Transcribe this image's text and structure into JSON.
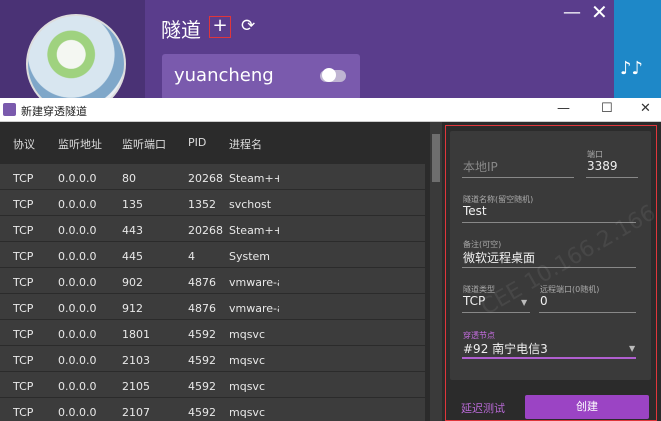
{
  "app": {
    "title": "隧道",
    "add_symbol": "+",
    "refresh_symbol": "⟳",
    "minimize_symbol": "—",
    "close_symbol": "✕",
    "tunnel_card": {
      "name": "yuancheng",
      "enabled": false
    },
    "icons": {
      "music": "music-note-icon"
    }
  },
  "dialog": {
    "title": "新建穿透隧道",
    "controls": {
      "minimize": "—",
      "maximize": "☐",
      "close": "✕"
    },
    "table": {
      "columns": [
        "协议",
        "监听地址",
        "监听端口",
        "PID",
        "进程名"
      ],
      "rows": [
        [
          "TCP",
          "0.0.0.0",
          "80",
          "20268",
          "Steam++"
        ],
        [
          "TCP",
          "0.0.0.0",
          "135",
          "1352",
          "svchost"
        ],
        [
          "TCP",
          "0.0.0.0",
          "443",
          "20268",
          "Steam++"
        ],
        [
          "TCP",
          "0.0.0.0",
          "445",
          "4",
          "System"
        ],
        [
          "TCP",
          "0.0.0.0",
          "902",
          "4876",
          "vmware-a"
        ],
        [
          "TCP",
          "0.0.0.0",
          "912",
          "4876",
          "vmware-a"
        ],
        [
          "TCP",
          "0.0.0.0",
          "1801",
          "4592",
          "mqsvc"
        ],
        [
          "TCP",
          "0.0.0.0",
          "2103",
          "4592",
          "mqsvc"
        ],
        [
          "TCP",
          "0.0.0.0",
          "2105",
          "4592",
          "mqsvc"
        ],
        [
          "TCP",
          "0.0.0.0",
          "2107",
          "4592",
          "mqsvc"
        ]
      ]
    },
    "form": {
      "local_ip": {
        "placeholder": "本地IP",
        "value": ""
      },
      "port": {
        "label": "端口",
        "value": "3389"
      },
      "tunnel_name": {
        "label": "隧道名称(留空随机)",
        "value": "Test"
      },
      "note": {
        "label": "备注(可空)",
        "value": "微软远程桌面"
      },
      "tunnel_type": {
        "label": "隧道类型",
        "value": "TCP"
      },
      "remote_port": {
        "label": "远程端口(0随机)",
        "value": "0"
      },
      "node": {
        "label": "穿透节点",
        "value": "#92 南宁电信3"
      },
      "latency_test": "延迟测试",
      "create": "创建"
    },
    "watermark": "CEE 10.166.2.166"
  },
  "colors": {
    "app_purple": "#5a3d8c",
    "accent_purple": "#9b44c4",
    "highlight_red": "#e0363b"
  }
}
